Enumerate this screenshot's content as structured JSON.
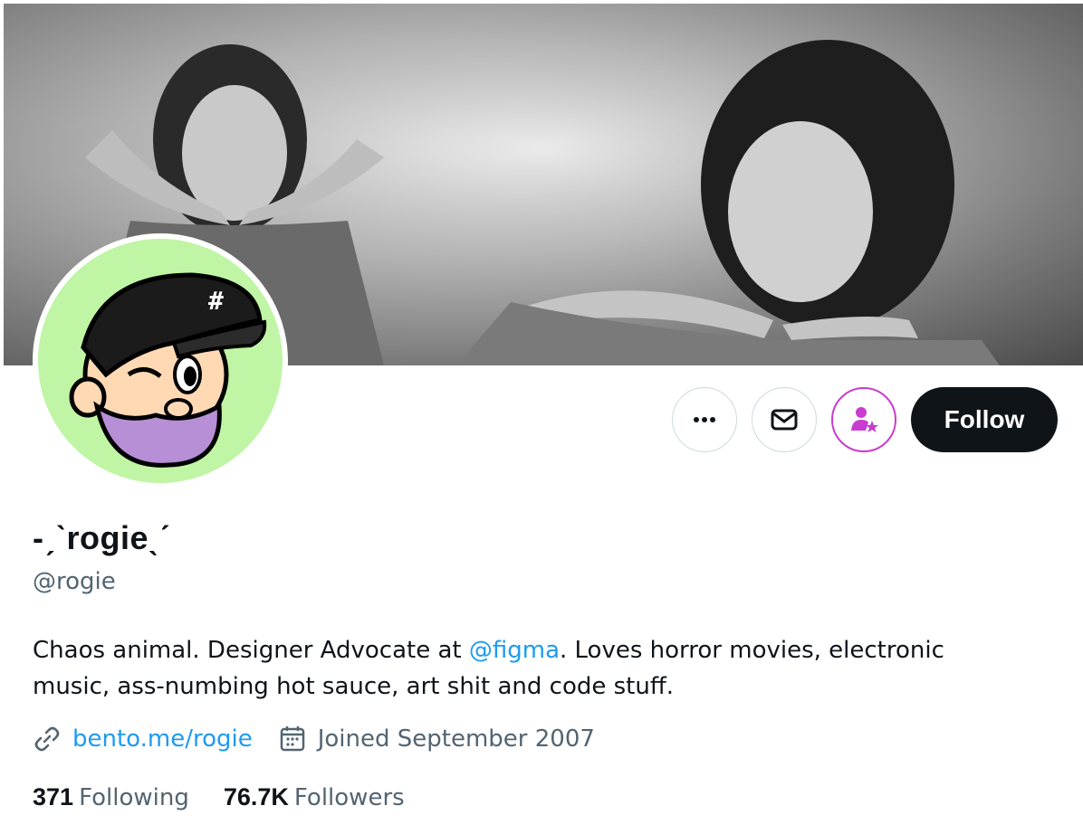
{
  "profile": {
    "display_name": "-ˏˋrogieˎˊ",
    "handle": "@rogie",
    "bio_before": "Chaos animal. Designer Advocate at ",
    "bio_mention": "@figma",
    "bio_after": ". Loves horror movies, electronic music, ass-numbing hot sauce, art shit and code stuff.",
    "website": "bento.me/rogie",
    "joined": "Joined September 2007"
  },
  "stats": {
    "following_count": "371",
    "following_label": "Following",
    "followers_count": "76.7K",
    "followers_label": "Followers"
  },
  "actions": {
    "follow_label": "Follow",
    "icons": [
      "more-icon",
      "message-icon",
      "subscribe-icon"
    ]
  },
  "colors": {
    "accent": "#1d9bf0",
    "text": "#0f1419",
    "muted": "#536471",
    "avatar_bg": "#bff5a4",
    "subscribe": "#c93ccf"
  }
}
